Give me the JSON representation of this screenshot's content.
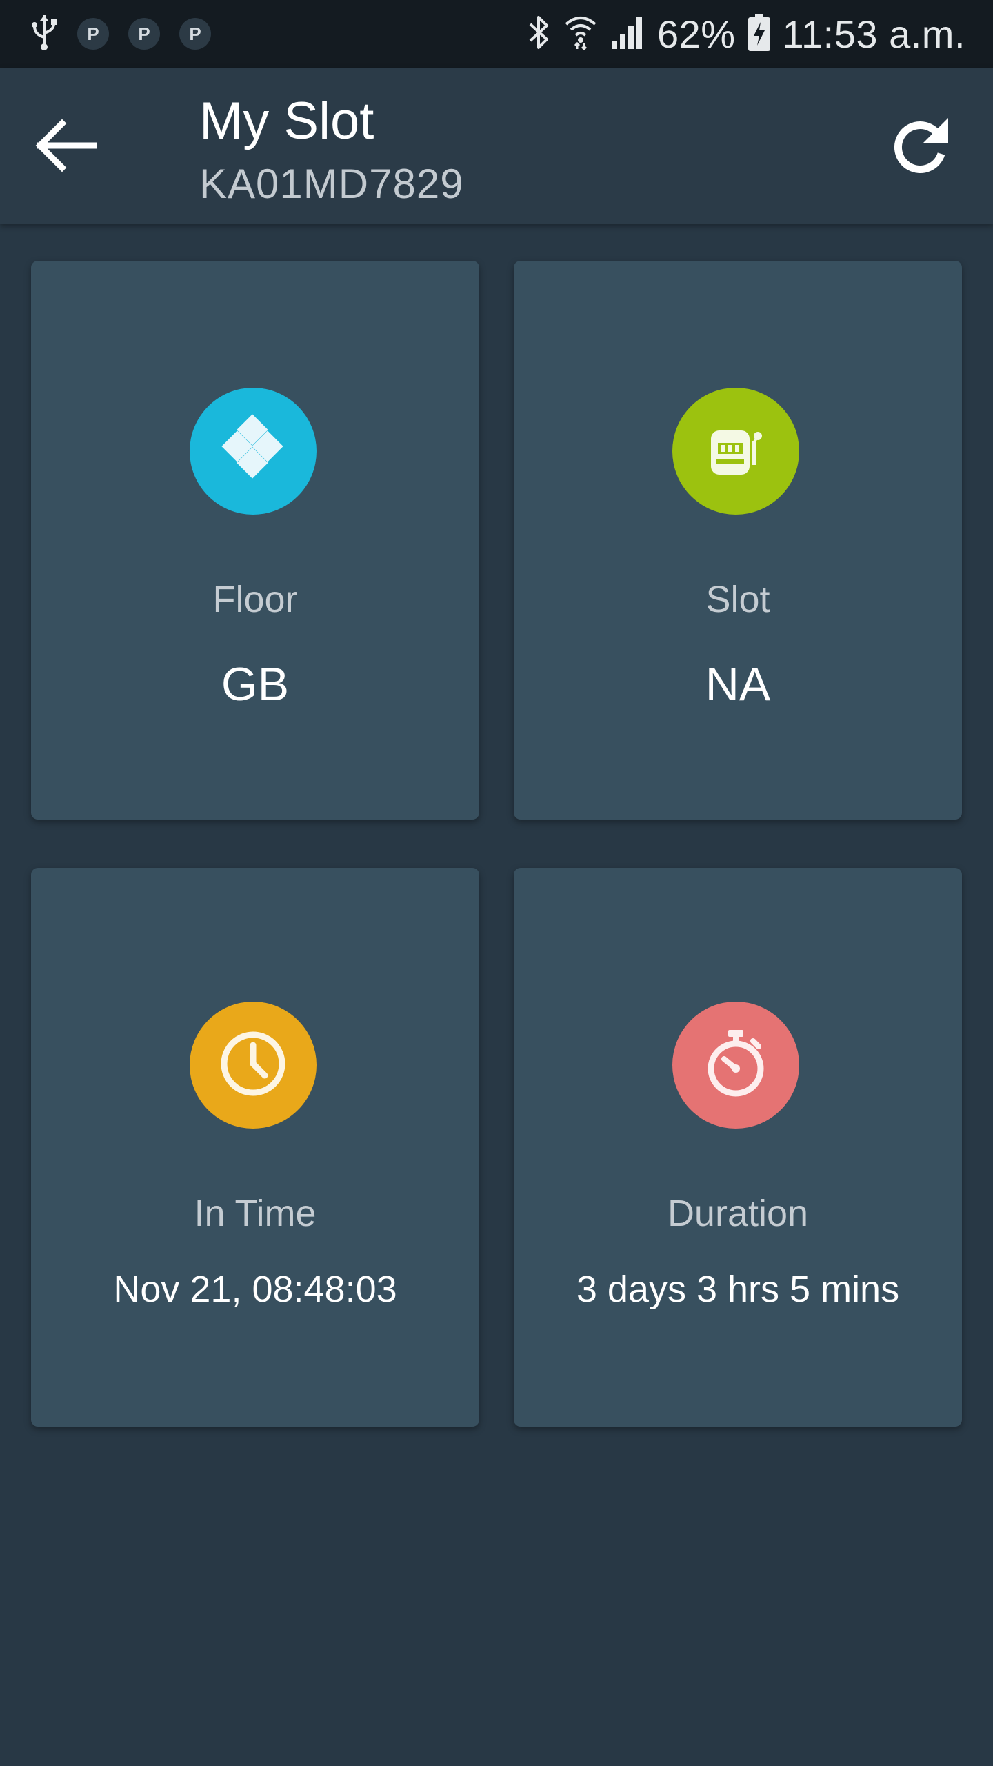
{
  "status_bar": {
    "battery": "62%",
    "time": "11:53 a.m.",
    "parking_badges": [
      "P",
      "P",
      "P"
    ]
  },
  "app_bar": {
    "title": "My Slot",
    "subtitle": "KA01MD7829",
    "back_icon": "arrow-left-icon",
    "refresh_icon": "refresh-icon"
  },
  "cards": [
    {
      "label": "Floor",
      "value": "GB",
      "icon": "floor-diamond-icon",
      "color": "#1ab8db"
    },
    {
      "label": "Slot",
      "value": "NA",
      "icon": "slot-machine-icon",
      "color": "#9cc20f"
    },
    {
      "label": "In Time",
      "value": "Nov 21, 08:48:03",
      "icon": "clock-icon",
      "color": "#e9a81a"
    },
    {
      "label": "Duration",
      "value": "3 days 3 hrs 5 mins",
      "icon": "stopwatch-icon",
      "color": "#e57373"
    }
  ]
}
